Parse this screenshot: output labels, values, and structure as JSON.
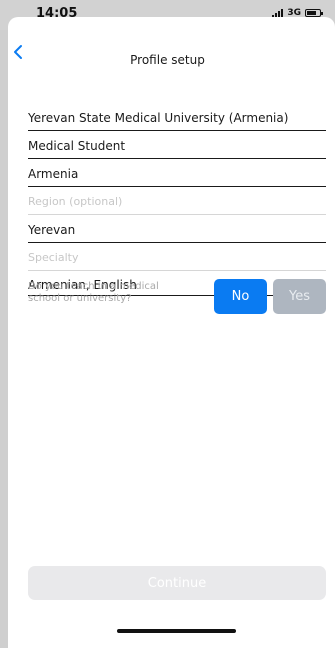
{
  "status_bar": {
    "time": "14:05",
    "network": "3G",
    "icons": [
      "signal-icon",
      "battery-icon"
    ]
  },
  "nav": {
    "back_icon": "chevron-left-icon",
    "title": "Profile setup"
  },
  "form": {
    "university": {
      "value": "Yerevan State Medical University (Armenia)",
      "placeholder": ""
    },
    "role": {
      "value": "Medical Student",
      "placeholder": ""
    },
    "country": {
      "value": "Armenia",
      "placeholder": ""
    },
    "region": {
      "value": "",
      "placeholder": "Region (optional)"
    },
    "city": {
      "value": "Yerevan",
      "placeholder": ""
    },
    "specialty": {
      "value": "",
      "placeholder": "Specialty"
    },
    "languages": {
      "value": "Armenian, English",
      "placeholder": ""
    },
    "teach_question": "Do you teach in a medical school or university?",
    "no_label": "No",
    "yes_label": "Yes"
  },
  "footer": {
    "continue_label": "Continue"
  },
  "colors": {
    "accent": "#0a7bf2",
    "disabled_button": "#aeb6c0",
    "continue_disabled": "#e9e9eb"
  }
}
